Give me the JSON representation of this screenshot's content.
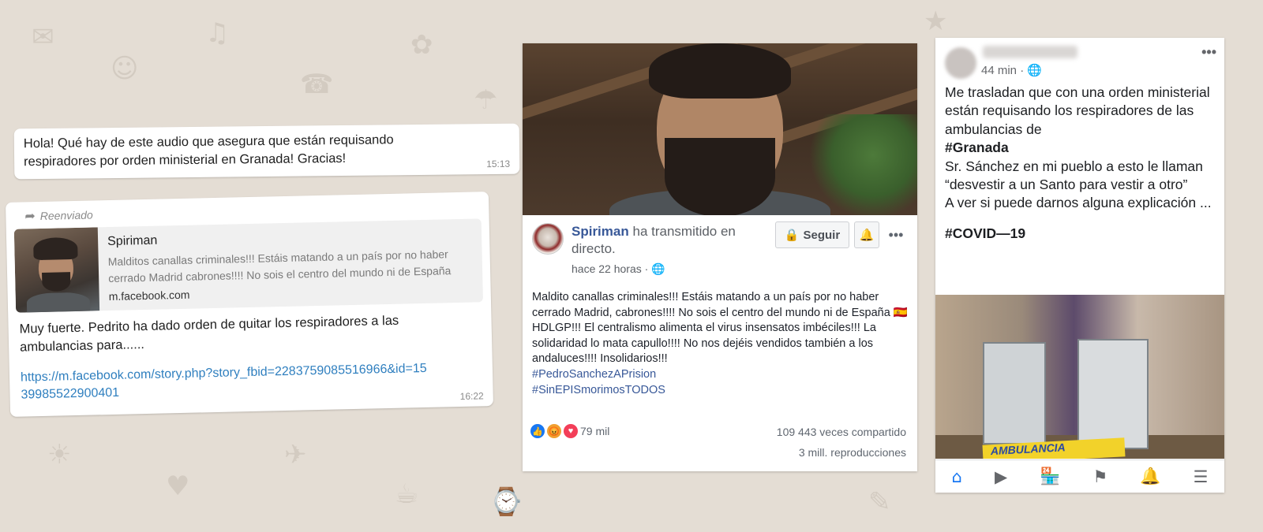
{
  "whatsapp": {
    "msg1": {
      "text": "Hola! Qué hay de este audio que asegura que están requisando respiradores por orden ministerial en Granada! Gracias!",
      "time": "15:13"
    },
    "msg2": {
      "forwarded_label": "Reenviado",
      "preview": {
        "title": "Spiriman",
        "description": "Malditos canallas criminales!!! Estáis matando a un país por no haber cerrado Madrid cabrones!!!! No sois el centro del mundo ni de España",
        "domain": "m.facebook.com"
      },
      "text": "Muy fuerte. Pedrito ha dado orden de quitar los respiradores a las ambulancias para......",
      "link": "https://m.facebook.com/story.php?story_fbid=2283759085516966&id=1539985522900401",
      "time": "16:22"
    }
  },
  "facebook_post": {
    "author": "Spiriman",
    "action": "ha transmitido en directo.",
    "time": "hace 22 horas · ",
    "follow_label": "Seguir",
    "body": "Maldito canallas criminales!!! Estáis matando a un país por no haber cerrado Madrid, cabrones!!!! No sois el centro del mundo ni de España 🇪🇸 HDLGP!!! El centralismo alimenta el virus insensatos imbéciles!!! La solidaridad lo mata capullo!!!! No nos dejéis vendidos también a los andaluces!!!! Insolidarios!!!",
    "hashtags": [
      "#PedroSanchezAPrision",
      "#SinEPISmorimosTODOS"
    ],
    "reactions_count": "79 mil",
    "shares": "109 443 veces compartido",
    "views": "3 mill. reproducciones"
  },
  "mobile_post": {
    "time": "44 min · ",
    "text_lines": [
      "Me trasladan que con una orden ministerial están requisando los respiradores de las ambulancias de",
      "#Granada",
      "Sr. Sánchez en mi pueblo a esto le llaman “desvestir a un Santo para vestir a otro”",
      "A ver si puede darnos alguna explicación ..."
    ],
    "hashtag": "#COVID—19",
    "photo_sign": "AMBULANCIA"
  },
  "colors": {
    "background": "#e4ddd4",
    "fb_blue": "#385898",
    "nav_active": "#1877f2",
    "link_blue": "#2f7fbf"
  }
}
